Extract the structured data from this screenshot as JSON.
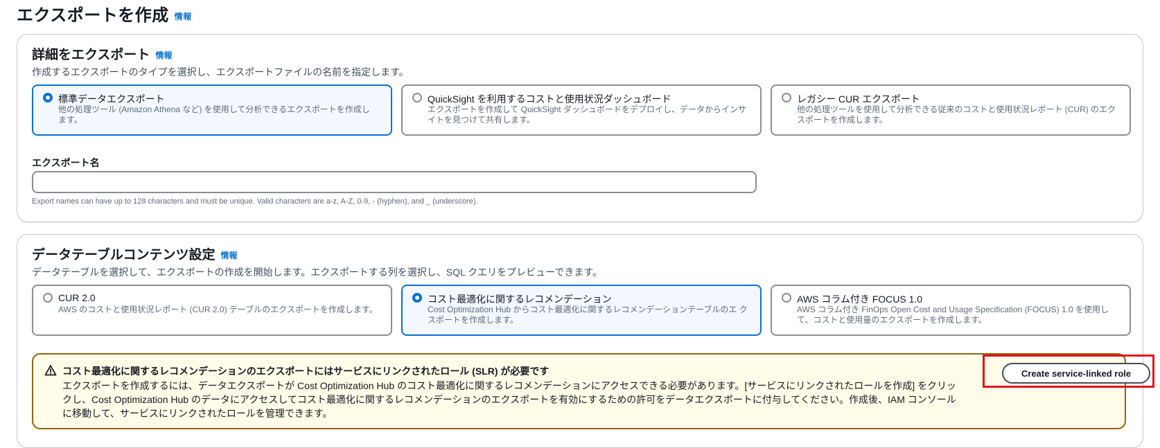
{
  "page": {
    "title": "エクスポートを作成",
    "info_label": "情報"
  },
  "export_details": {
    "header": "詳細をエクスポート",
    "info_label": "情報",
    "description": "作成するエクスポートのタイプを選択し、エクスポートファイルの名前を指定します。",
    "types": [
      {
        "title": "標準データエクスポート",
        "description": "他の処理ツール (Amazon Athena など) を使用して分析できるエクスポートを作成し ます。",
        "selected": true
      },
      {
        "title": "QuickSight を利用するコストと使用状況ダッシュボード",
        "description": "エクスポートを作成して QuickSight ダッシュボードをデプロイし、データからインサ イトを見つけて共有します。",
        "selected": false
      },
      {
        "title": "レガシー CUR エクスポート",
        "description": "他の処理ツールを使用して分析できる従来のコストと使用状況レポート (CUR) のエク スポートを作成します。",
        "selected": false
      }
    ],
    "name_label": "エクスポート名",
    "name_value": "",
    "name_constraint": "Export names can have up to 128 characters and must be unique. Valid characters are a-z, A-Z, 0-9, - (hyphen), and _ (underscore)."
  },
  "table_content": {
    "header": "データテーブルコンテンツ設定",
    "info_label": "情報",
    "description": "データテーブルを選択して、エクスポートの作成を開始します。エクスポートする列を選択し、SQL クエリをプレビューできます。",
    "tables": [
      {
        "title": "CUR 2.0",
        "description": "AWS のコストと使用状況レポート (CUR 2.0) テーブルのエクスポートを作成します。",
        "selected": false
      },
      {
        "title": "コスト最適化に関するレコメンデーション",
        "description": "Cost Optimization Hub からコスト最適化に関するレコメンデーションテーブルのエ クスポートを作成します。",
        "selected": true
      },
      {
        "title": "AWS コラム付き FOCUS 1.0",
        "description": "AWS コラム付き FinOps Open Cost and Usage Specification (FOCUS) 1.0 を使用し て、コストと使用量のエクスポートを作成します。",
        "selected": false
      }
    ],
    "alert": {
      "title": "コスト最適化に関するレコメンデーションのエクスポートにはサービスにリンクされたロール (SLR) が必要です",
      "body": "エクスポートを作成するには、データエクスポートが Cost Optimization Hub のコスト最適化に関するレコメンデーションにアクセスできる必要があります。[サービスにリンクされたロールを作成] をクリックし、Cost Optimization Hub のデータにアクセスしてコスト最適化に関するレコメンデーションのエクスポートを有効にするための許可をデータエクスポートに付与してください。作成後、IAM コンソールに移動して、サービスにリンクされたロールを管理できます。",
      "button_label": "Create service-linked role",
      "icon": "warning-icon"
    }
  },
  "colors": {
    "selected_border": "#0972d3",
    "warning_border": "#8d6605",
    "warning_bg": "#fffce9",
    "highlight_red": "#e3121c"
  }
}
